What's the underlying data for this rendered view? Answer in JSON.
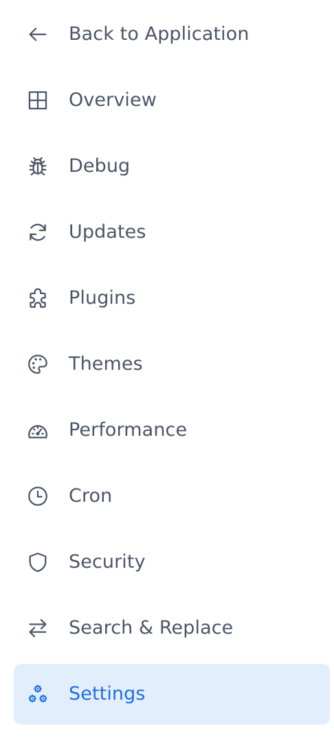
{
  "colors": {
    "text": "#4b5567",
    "active_text": "#1f6fe5",
    "active_background": "#e3eefc"
  },
  "sidebar": {
    "items": [
      {
        "label": "Back to Application",
        "icon": "arrow-left-icon",
        "active": false
      },
      {
        "label": "Overview",
        "icon": "grid-icon",
        "active": false
      },
      {
        "label": "Debug",
        "icon": "bug-icon",
        "active": false
      },
      {
        "label": "Updates",
        "icon": "refresh-icon",
        "active": false
      },
      {
        "label": "Plugins",
        "icon": "puzzle-icon",
        "active": false
      },
      {
        "label": "Themes",
        "icon": "palette-icon",
        "active": false
      },
      {
        "label": "Performance",
        "icon": "speedometer-icon",
        "active": false
      },
      {
        "label": "Cron",
        "icon": "clock-icon",
        "active": false
      },
      {
        "label": "Security",
        "icon": "shield-icon",
        "active": false
      },
      {
        "label": "Search & Replace",
        "icon": "arrows-swap-icon",
        "active": false
      },
      {
        "label": "Settings",
        "icon": "cogs-icon",
        "active": true
      }
    ]
  }
}
